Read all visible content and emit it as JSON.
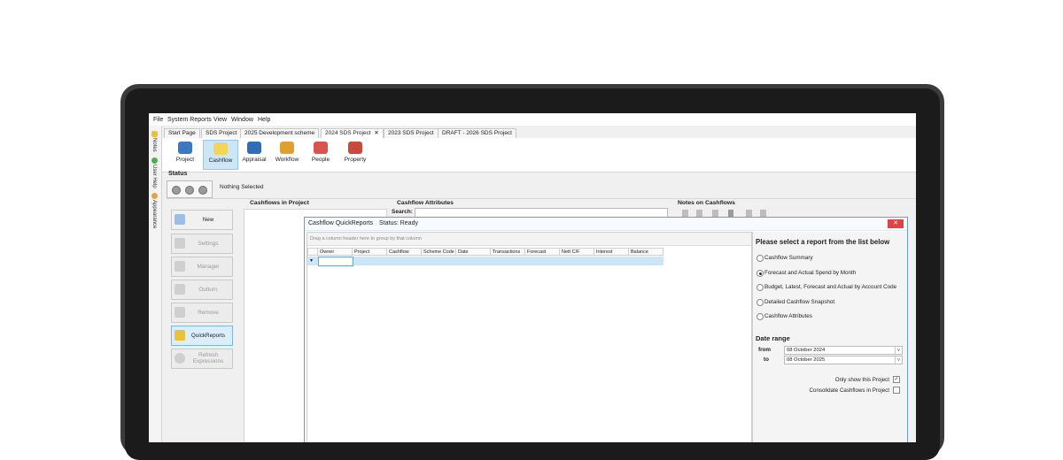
{
  "menu": [
    "File",
    "System Reports",
    "View",
    "Window",
    "Help"
  ],
  "side": {
    "notes": "Notes",
    "user_help": "User Help",
    "appearance": "Appearance"
  },
  "tabs": [
    {
      "label": "Start Page"
    },
    {
      "label": "SDS Project"
    },
    {
      "label": "2025 Development scheme"
    },
    {
      "label": "2024 SDS Project",
      "close": "✕"
    },
    {
      "label": "2023 SDS Project"
    },
    {
      "label": "DRAFT - 2026 SDS Project"
    }
  ],
  "ribbon": [
    "Project",
    "Cashflow",
    "Appraisal",
    "Workflow",
    "People",
    "Property"
  ],
  "status": {
    "title": "Status",
    "text": "Nothing Selected"
  },
  "left_buttons": [
    "New",
    "Settings",
    "Manager",
    "Outturn",
    "Remove",
    "QuickReports",
    "Refresh Expressions"
  ],
  "panels": {
    "cashflows": "Cashflows in Project",
    "attributes": "Cashflow Attributes",
    "search_label": "Search:",
    "notes": "Notes on Cashflows"
  },
  "dialog": {
    "title": "Cashflow QuickReports",
    "status": "Status: Ready",
    "close": "✕",
    "group_hint": "Drag a column header here to group by that column",
    "columns": [
      "Owner",
      "Project",
      "Cashflow",
      "Scheme Code",
      "Date",
      "Transactions",
      "Forecast",
      "Nett C/F",
      "Interest",
      "Balance"
    ],
    "row_marker": "▾",
    "report_title": "Please select a report from the list below",
    "reports": [
      {
        "label": "Cashflow Summary",
        "selected": false
      },
      {
        "label": "Forecast and Actual Spend by Month",
        "selected": true
      },
      {
        "label": "Budget, Latest, Forecast and Actual by Account Code",
        "selected": false
      },
      {
        "label": "Detailed Cashflow Snapshot",
        "selected": false
      },
      {
        "label": "Cashflow Attributes",
        "selected": false
      }
    ],
    "date_range": {
      "title": "Date range",
      "from_label": "from",
      "from": "08 October 2024",
      "to_label": "to",
      "to": "08 October 2025",
      "dropdown": "v"
    },
    "options": [
      {
        "label": "Only show this Project",
        "checked": true,
        "mark": "✓"
      },
      {
        "label": "Consolidate Cashflows in Project",
        "checked": false,
        "mark": ""
      }
    ]
  },
  "colors": {
    "accent": "#cde6f7",
    "close": "#e04343",
    "selection_row": "#cbe7f7"
  }
}
